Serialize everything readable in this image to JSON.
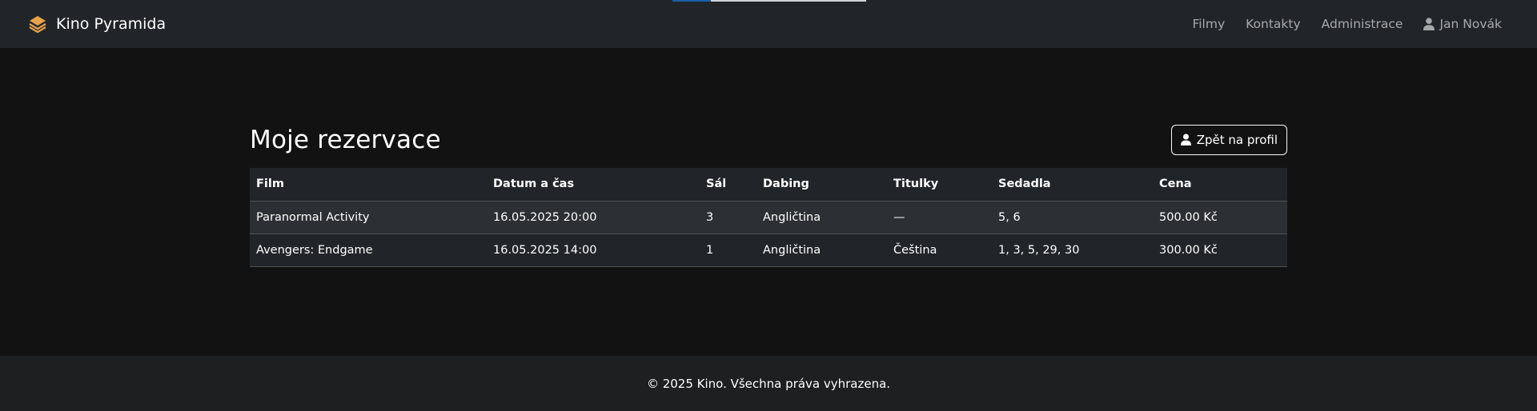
{
  "nav": {
    "brand": "Kino Pyramida",
    "links": [
      "Filmy",
      "Kontakty",
      "Administrace"
    ],
    "user": "Jan Novák"
  },
  "page": {
    "title": "Moje rezervace",
    "back_button": "Zpět na profil"
  },
  "table": {
    "headers": [
      "Film",
      "Datum a čas",
      "Sál",
      "Dabing",
      "Titulky",
      "Sedadla",
      "Cena"
    ],
    "rows": [
      [
        "Paranormal Activity",
        "16.05.2025 20:00",
        "3",
        "Angličtina",
        "—",
        "5, 6",
        "500.00 Kč"
      ],
      [
        "Avengers: Endgame",
        "16.05.2025 14:00",
        "1",
        "Angličtina",
        "Čeština",
        "1, 3, 5, 29, 30",
        "300.00 Kč"
      ]
    ]
  },
  "footer": {
    "text": "© 2025 Kino. Všechna práva vyhrazena."
  },
  "colors": {
    "navbar": "#212529",
    "background": "#121212",
    "brand_icon": "#e8a24a",
    "footer": "#1e1f21"
  }
}
